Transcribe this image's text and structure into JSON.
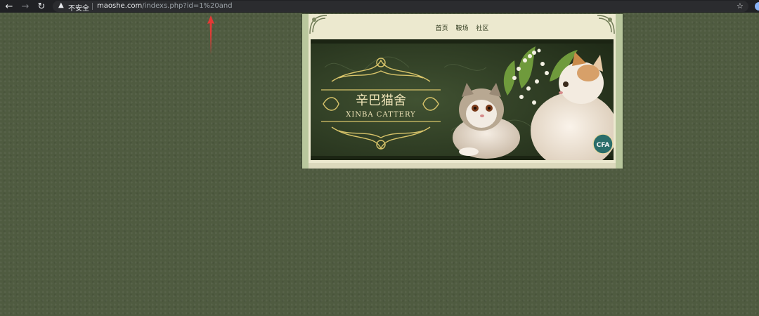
{
  "browser": {
    "security_label": "不安全",
    "url_host": "maoshe.com",
    "url_path": "/indexs.php?id=1%20and"
  },
  "site": {
    "nav_items": [
      "首页",
      "鞍场",
      "社区"
    ],
    "banner": {
      "title_cn": "辛巴猫舍",
      "title_en": "XINBA CATTERY",
      "badge_text": "CFA"
    }
  },
  "colors": {
    "page_background": "#4f5b40",
    "browser_bar": "#202124",
    "banner_background": "#2d3a22",
    "banner_gold": "#d8c46a",
    "annotation_arrow": "#e53935"
  }
}
